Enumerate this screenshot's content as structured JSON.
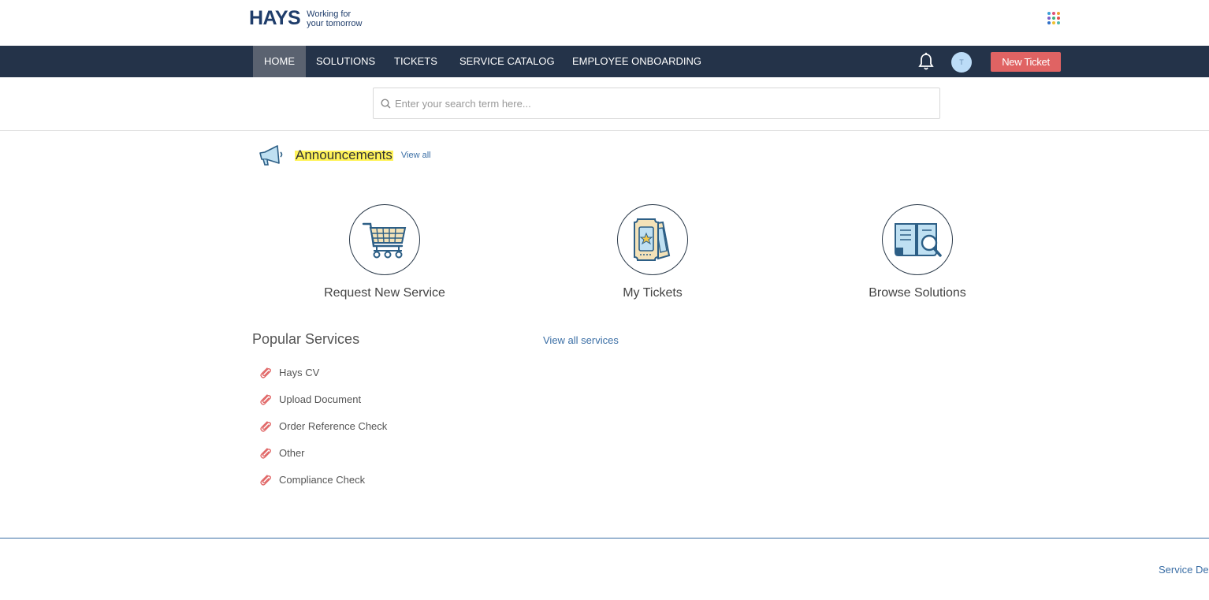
{
  "brand": {
    "name": "HAYS",
    "tagline_line1": "Working for",
    "tagline_line2": "your tomorrow"
  },
  "nav": {
    "items": [
      {
        "label": "HOME",
        "active": true
      },
      {
        "label": "SOLUTIONS",
        "active": false
      },
      {
        "label": "TICKETS",
        "active": false
      },
      {
        "label": "SERVICE CATALOG",
        "active": false
      },
      {
        "label": "EMPLOYEE ONBOARDING",
        "active": false
      }
    ],
    "avatar_initial": "T",
    "new_ticket_label": "New Ticket"
  },
  "search": {
    "placeholder": "Enter your search term here..."
  },
  "announcements": {
    "title": "Announcements",
    "view_all_label": "View all"
  },
  "tiles": [
    {
      "label": "Request New Service",
      "icon": "shopping-cart-icon"
    },
    {
      "label": "My Tickets",
      "icon": "ticket-icon"
    },
    {
      "label": "Browse Solutions",
      "icon": "book-search-icon"
    }
  ],
  "popular": {
    "title": "Popular Services",
    "view_all_label": "View all services",
    "items": [
      {
        "label": "Hays CV",
        "icon": "paperclip-icon"
      },
      {
        "label": "Upload Document",
        "icon": "paperclip-icon"
      },
      {
        "label": "Order Reference Check",
        "icon": "paperclip-icon"
      },
      {
        "label": "Other",
        "icon": "paperclip-icon"
      },
      {
        "label": "Compliance Check",
        "icon": "paperclip-icon"
      }
    ]
  },
  "footer": {
    "link_label": "Service Des"
  },
  "colors": {
    "navbar": "#243349",
    "nav_active": "#5a6270",
    "new_ticket": "#e06363",
    "link": "#3a6ea5",
    "highlight": "#fff35a",
    "brand": "#1f3d6b"
  }
}
